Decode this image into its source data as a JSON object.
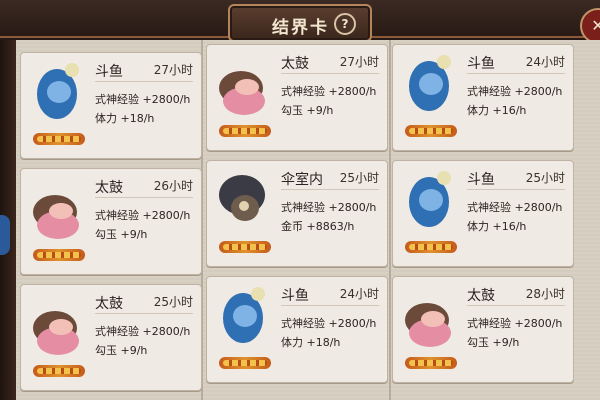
{
  "header": {
    "title": "结界卡"
  },
  "cards": [
    {
      "name": "斗鱼",
      "duration": "27小时",
      "row1": "式神经验 +2800/h",
      "row2": "体力 +18/h",
      "icon": "fish-icon"
    },
    {
      "name": "太鼓",
      "duration": "27小时",
      "row1": "式神经验 +2800/h",
      "row2": "勾玉 +9/h",
      "icon": "drum-icon"
    },
    {
      "name": "斗鱼",
      "duration": "24小时",
      "row1": "式神经验 +2800/h",
      "row2": "体力 +16/h",
      "icon": "fish-icon"
    },
    {
      "name": "太鼓",
      "duration": "26小时",
      "row1": "式神经验 +2800/h",
      "row2": "勾玉 +9/h",
      "icon": "drum-icon"
    },
    {
      "name": "伞室内",
      "duration": "25小时",
      "row1": "式神经验 +2800/h",
      "row2": "金币 +8863/h",
      "icon": "umbrella-room-icon"
    },
    {
      "name": "斗鱼",
      "duration": "25小时",
      "row1": "式神经验 +2800/h",
      "row2": "体力 +16/h",
      "icon": "fish-icon"
    },
    {
      "name": "太鼓",
      "duration": "25小时",
      "row1": "式神经验 +2800/h",
      "row2": "勾玉 +9/h",
      "icon": "drum-icon"
    },
    {
      "name": "斗鱼",
      "duration": "24小时",
      "row1": "式神经验 +2800/h",
      "row2": "体力 +18/h",
      "icon": "fish-icon"
    },
    {
      "name": "太鼓",
      "duration": "28小时",
      "row1": "式神经验 +2800/h",
      "row2": "勾玉 +9/h",
      "icon": "drum-icon"
    }
  ],
  "colors": {
    "card_bg": "#efeae4",
    "panel_bg": "#d9d0c4",
    "frame_dark": "#2a1a14"
  }
}
